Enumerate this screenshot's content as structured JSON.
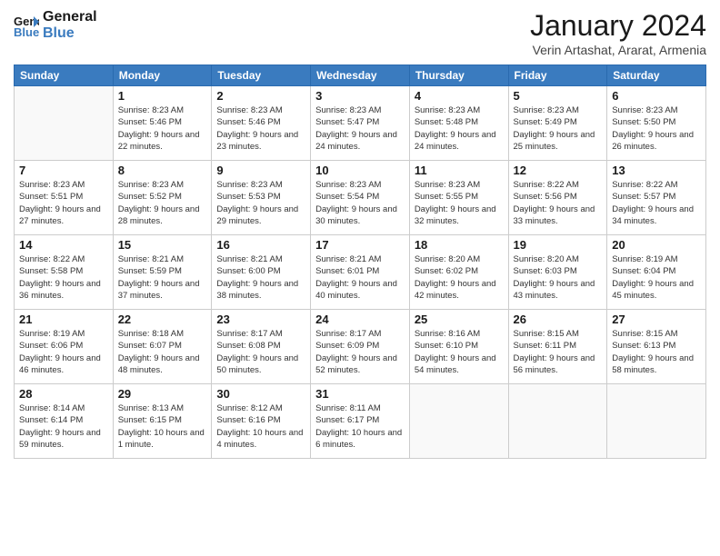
{
  "header": {
    "logo_line1": "General",
    "logo_line2": "Blue",
    "month_title": "January 2024",
    "subtitle": "Verin Artashat, Ararat, Armenia"
  },
  "weekdays": [
    "Sunday",
    "Monday",
    "Tuesday",
    "Wednesday",
    "Thursday",
    "Friday",
    "Saturday"
  ],
  "weeks": [
    [
      {
        "day": "",
        "sunrise": "",
        "sunset": "",
        "daylight": ""
      },
      {
        "day": "1",
        "sunrise": "Sunrise: 8:23 AM",
        "sunset": "Sunset: 5:46 PM",
        "daylight": "Daylight: 9 hours and 22 minutes."
      },
      {
        "day": "2",
        "sunrise": "Sunrise: 8:23 AM",
        "sunset": "Sunset: 5:46 PM",
        "daylight": "Daylight: 9 hours and 23 minutes."
      },
      {
        "day": "3",
        "sunrise": "Sunrise: 8:23 AM",
        "sunset": "Sunset: 5:47 PM",
        "daylight": "Daylight: 9 hours and 24 minutes."
      },
      {
        "day": "4",
        "sunrise": "Sunrise: 8:23 AM",
        "sunset": "Sunset: 5:48 PM",
        "daylight": "Daylight: 9 hours and 24 minutes."
      },
      {
        "day": "5",
        "sunrise": "Sunrise: 8:23 AM",
        "sunset": "Sunset: 5:49 PM",
        "daylight": "Daylight: 9 hours and 25 minutes."
      },
      {
        "day": "6",
        "sunrise": "Sunrise: 8:23 AM",
        "sunset": "Sunset: 5:50 PM",
        "daylight": "Daylight: 9 hours and 26 minutes."
      }
    ],
    [
      {
        "day": "7",
        "sunrise": "Sunrise: 8:23 AM",
        "sunset": "Sunset: 5:51 PM",
        "daylight": "Daylight: 9 hours and 27 minutes."
      },
      {
        "day": "8",
        "sunrise": "Sunrise: 8:23 AM",
        "sunset": "Sunset: 5:52 PM",
        "daylight": "Daylight: 9 hours and 28 minutes."
      },
      {
        "day": "9",
        "sunrise": "Sunrise: 8:23 AM",
        "sunset": "Sunset: 5:53 PM",
        "daylight": "Daylight: 9 hours and 29 minutes."
      },
      {
        "day": "10",
        "sunrise": "Sunrise: 8:23 AM",
        "sunset": "Sunset: 5:54 PM",
        "daylight": "Daylight: 9 hours and 30 minutes."
      },
      {
        "day": "11",
        "sunrise": "Sunrise: 8:23 AM",
        "sunset": "Sunset: 5:55 PM",
        "daylight": "Daylight: 9 hours and 32 minutes."
      },
      {
        "day": "12",
        "sunrise": "Sunrise: 8:22 AM",
        "sunset": "Sunset: 5:56 PM",
        "daylight": "Daylight: 9 hours and 33 minutes."
      },
      {
        "day": "13",
        "sunrise": "Sunrise: 8:22 AM",
        "sunset": "Sunset: 5:57 PM",
        "daylight": "Daylight: 9 hours and 34 minutes."
      }
    ],
    [
      {
        "day": "14",
        "sunrise": "Sunrise: 8:22 AM",
        "sunset": "Sunset: 5:58 PM",
        "daylight": "Daylight: 9 hours and 36 minutes."
      },
      {
        "day": "15",
        "sunrise": "Sunrise: 8:21 AM",
        "sunset": "Sunset: 5:59 PM",
        "daylight": "Daylight: 9 hours and 37 minutes."
      },
      {
        "day": "16",
        "sunrise": "Sunrise: 8:21 AM",
        "sunset": "Sunset: 6:00 PM",
        "daylight": "Daylight: 9 hours and 38 minutes."
      },
      {
        "day": "17",
        "sunrise": "Sunrise: 8:21 AM",
        "sunset": "Sunset: 6:01 PM",
        "daylight": "Daylight: 9 hours and 40 minutes."
      },
      {
        "day": "18",
        "sunrise": "Sunrise: 8:20 AM",
        "sunset": "Sunset: 6:02 PM",
        "daylight": "Daylight: 9 hours and 42 minutes."
      },
      {
        "day": "19",
        "sunrise": "Sunrise: 8:20 AM",
        "sunset": "Sunset: 6:03 PM",
        "daylight": "Daylight: 9 hours and 43 minutes."
      },
      {
        "day": "20",
        "sunrise": "Sunrise: 8:19 AM",
        "sunset": "Sunset: 6:04 PM",
        "daylight": "Daylight: 9 hours and 45 minutes."
      }
    ],
    [
      {
        "day": "21",
        "sunrise": "Sunrise: 8:19 AM",
        "sunset": "Sunset: 6:06 PM",
        "daylight": "Daylight: 9 hours and 46 minutes."
      },
      {
        "day": "22",
        "sunrise": "Sunrise: 8:18 AM",
        "sunset": "Sunset: 6:07 PM",
        "daylight": "Daylight: 9 hours and 48 minutes."
      },
      {
        "day": "23",
        "sunrise": "Sunrise: 8:17 AM",
        "sunset": "Sunset: 6:08 PM",
        "daylight": "Daylight: 9 hours and 50 minutes."
      },
      {
        "day": "24",
        "sunrise": "Sunrise: 8:17 AM",
        "sunset": "Sunset: 6:09 PM",
        "daylight": "Daylight: 9 hours and 52 minutes."
      },
      {
        "day": "25",
        "sunrise": "Sunrise: 8:16 AM",
        "sunset": "Sunset: 6:10 PM",
        "daylight": "Daylight: 9 hours and 54 minutes."
      },
      {
        "day": "26",
        "sunrise": "Sunrise: 8:15 AM",
        "sunset": "Sunset: 6:11 PM",
        "daylight": "Daylight: 9 hours and 56 minutes."
      },
      {
        "day": "27",
        "sunrise": "Sunrise: 8:15 AM",
        "sunset": "Sunset: 6:13 PM",
        "daylight": "Daylight: 9 hours and 58 minutes."
      }
    ],
    [
      {
        "day": "28",
        "sunrise": "Sunrise: 8:14 AM",
        "sunset": "Sunset: 6:14 PM",
        "daylight": "Daylight: 9 hours and 59 minutes."
      },
      {
        "day": "29",
        "sunrise": "Sunrise: 8:13 AM",
        "sunset": "Sunset: 6:15 PM",
        "daylight": "Daylight: 10 hours and 1 minute."
      },
      {
        "day": "30",
        "sunrise": "Sunrise: 8:12 AM",
        "sunset": "Sunset: 6:16 PM",
        "daylight": "Daylight: 10 hours and 4 minutes."
      },
      {
        "day": "31",
        "sunrise": "Sunrise: 8:11 AM",
        "sunset": "Sunset: 6:17 PM",
        "daylight": "Daylight: 10 hours and 6 minutes."
      },
      {
        "day": "",
        "sunrise": "",
        "sunset": "",
        "daylight": ""
      },
      {
        "day": "",
        "sunrise": "",
        "sunset": "",
        "daylight": ""
      },
      {
        "day": "",
        "sunrise": "",
        "sunset": "",
        "daylight": ""
      }
    ]
  ]
}
